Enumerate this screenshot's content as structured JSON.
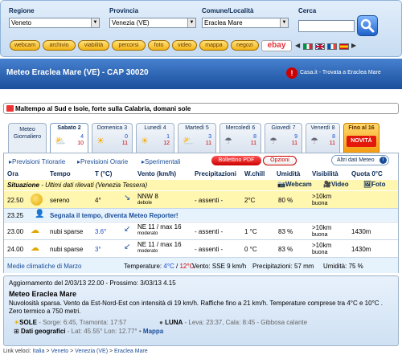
{
  "search": {
    "regione_label": "Regione",
    "regione_value": "Veneto",
    "provincia_label": "Provincia",
    "provincia_value": "Venezia (VE)",
    "comune_label": "Comune/Località",
    "comune_value": "Eraclea Mare",
    "cerca_label": "Cerca",
    "cerca_placeholder": ""
  },
  "nav_pills": [
    "webcam",
    "archivio",
    "viabilità",
    "percorsi",
    "foto",
    "video",
    "mappa",
    "negozi"
  ],
  "ebay_label": "ebay",
  "flags": [
    "it",
    "uk",
    "fr",
    "es"
  ],
  "page": {
    "title": "Meteo Eraclea Mare (VE) - CAP 30020",
    "casa_link": "Casa.it - Trovata a Eraclea Mare",
    "alert": "Maltempo al Sud e Isole, forte sulla Calabria, domani sole"
  },
  "tabs": [
    {
      "label": "Meteo\nGiornaliero"
    },
    {
      "label": "Sabato 2",
      "icon": "sun-cloud",
      "max": "4",
      "min": "10"
    },
    {
      "label": "Domenica 3",
      "icon": "sun",
      "max": "0",
      "min": "11"
    },
    {
      "label": "Lunedì 4",
      "icon": "sun",
      "max": "1",
      "min": "12"
    },
    {
      "label": "Martedì 5",
      "icon": "sun-cloud",
      "max": "3",
      "min": "11"
    },
    {
      "label": "Mercoledì 6",
      "icon": "rain",
      "max": "8",
      "min": "11"
    },
    {
      "label": "Giovedì 7",
      "icon": "rain",
      "max": "9",
      "min": "11"
    },
    {
      "label": "Venerdì 8",
      "icon": "rain",
      "max": "8",
      "min": "11"
    },
    {
      "label": "Fino al 16",
      "badge": "NOVITÀ"
    }
  ],
  "subnav": {
    "triorarie": "Previsioni Triorarie",
    "orarie": "Previsioni Orarie",
    "sperimentali": "Sperimentali",
    "bollettino": "Bollettino PDF",
    "opzioni": "Opzioni",
    "altri": "Altri dati Meteo"
  },
  "table": {
    "headers": [
      "Ora",
      "Tempo",
      "T (°C)",
      "Vento (km/h)",
      "Precipitazioni",
      "W.chill",
      "Umidità",
      "Visibilità",
      "Quota 0°C"
    ],
    "situazione_label": "Situazione",
    "situazione_text": "- Ultimi dati rilevati (Venezia Tessera)",
    "webcam": "Webcam",
    "video": "Video",
    "foto": "Foto",
    "segnala": "Segnala il tempo, diventa Meteo Reporter!",
    "rows": [
      {
        "ora": "22.50",
        "tempo": "sereno",
        "t": "4°",
        "vento": "NNW 8",
        "vento2": "debole",
        "prec": "- assenti -",
        "wchill": "2°C",
        "umid": "80 %",
        "vis": ">10km",
        "vis2": "buona",
        "quota": ""
      },
      {
        "ora": "23.25",
        "tempo": "",
        "t": "",
        "vento": "",
        "vento2": "",
        "prec": "",
        "wchill": "",
        "umid": "",
        "vis": "",
        "vis2": "",
        "quota": ""
      },
      {
        "ora": "23.00",
        "tempo": "nubi sparse",
        "t": "3.6°",
        "vento": "NE 11 / max 16",
        "vento2": "moderato",
        "prec": "- assenti -",
        "wchill": "1 °C",
        "umid": "83 %",
        "vis": ">10km",
        "vis2": "buona",
        "quota": "1430m"
      },
      {
        "ora": "24.00",
        "tempo": "nubi sparse",
        "t": "3°",
        "vento": "NE 11 / max 16",
        "vento2": "moderato",
        "prec": "- assenti -",
        "wchill": "0 °C",
        "umid": "83 %",
        "vis": ">10km",
        "vis2": "buona",
        "quota": "1430m"
      }
    ],
    "climatiche_label": "Medie climatiche di Marzo",
    "climatiche_temp_label": "Temperature:",
    "climatiche_min": "4°C",
    "climatiche_max": "12°C",
    "climatiche_vento": "Vento: SSE 9 km/h",
    "climatiche_prec": "Precipitazioni: 57 mm",
    "climatiche_umid": "Umidità: 75 %"
  },
  "summary": {
    "update": "Aggiornamento del 2/03/13 22.00 - Prossimo: 3/03/13 4.15",
    "title": "Meteo Eraclea Mare",
    "text": "Nuvolosità sparsa. Vento da Est-Nord-Est con intensità di 19 km/h. Raffiche fino a 21 km/h. Temperature comprese tra 4°C e 10°C . Zero termico a 750 metri.",
    "sole": "SOLE",
    "sole_text": "- Sorge: 6:45, Tramonta: 17:57",
    "luna": "LUNA",
    "luna_text": "- Leva: 23:37, Cala: 8:45 - Gibbosa calante",
    "geo": "Dati geografici",
    "geo_text": "- Lat: 45.55°  Lon: 12.77° •",
    "mappa": "Mappa"
  },
  "footer": {
    "label": "Link veloci:",
    "links": [
      "Italia",
      "Veneto",
      "Venezia (VE)",
      "Eraclea Mare"
    ]
  },
  "colors": {
    "accent": "#1b4f9c",
    "pill": "#f3b516",
    "alert_red": "#cc0000",
    "highlight": "#fff6b0"
  }
}
